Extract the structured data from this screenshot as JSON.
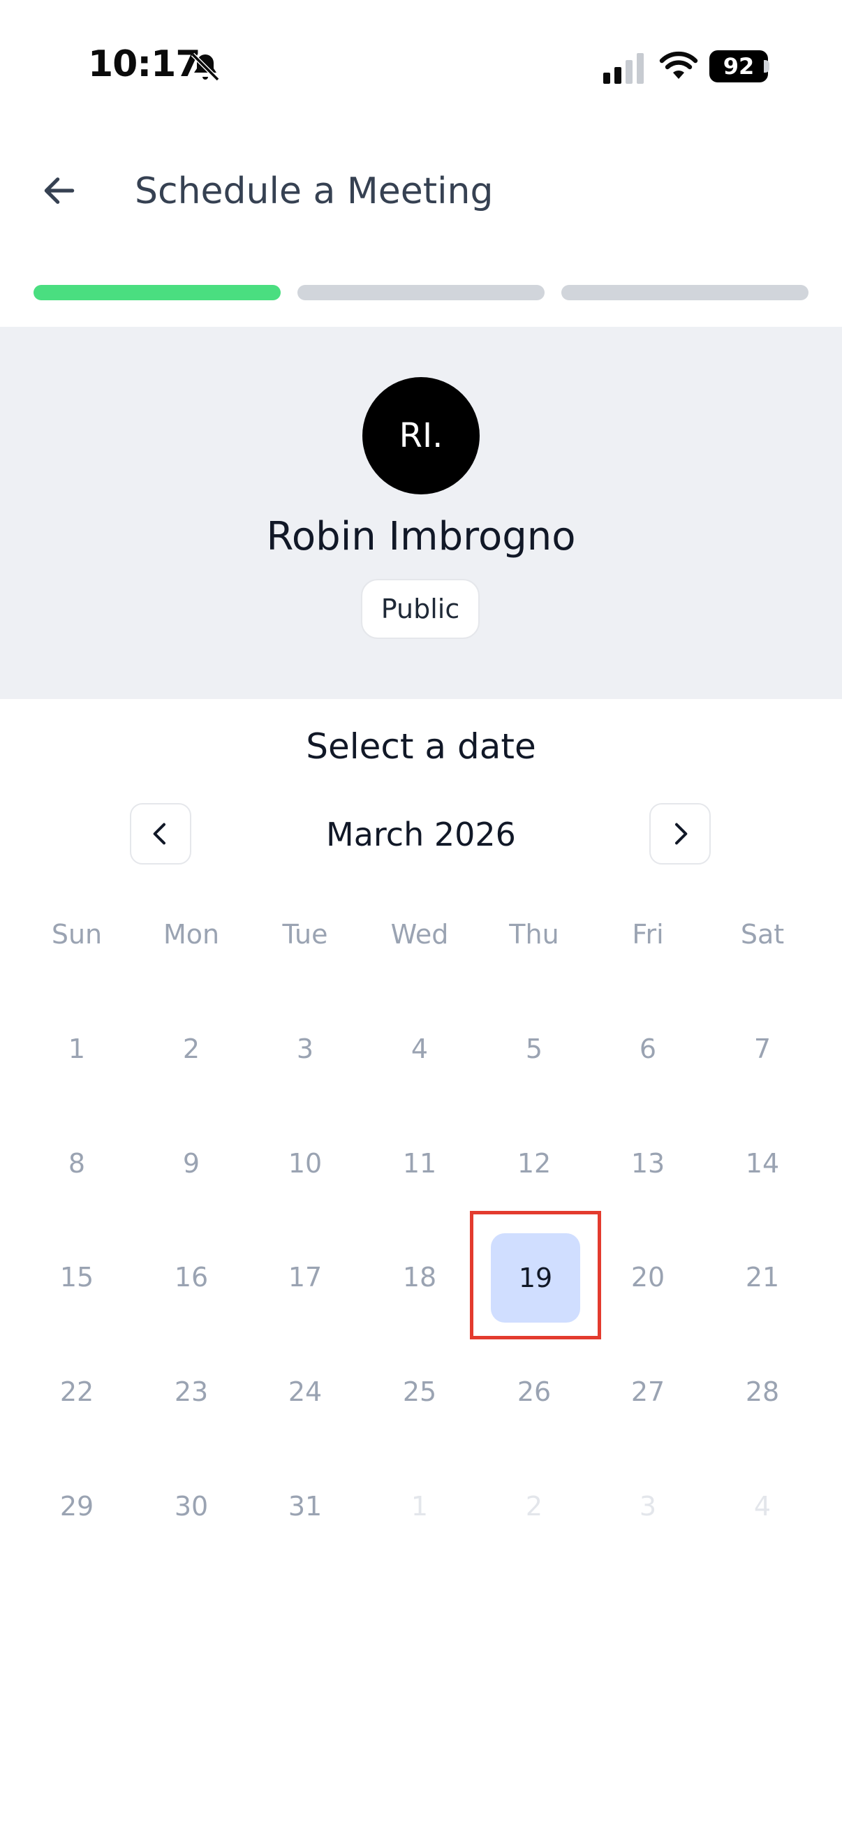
{
  "status_bar": {
    "time": "10:17",
    "battery": "92"
  },
  "header": {
    "title": "Schedule a Meeting"
  },
  "progress": {
    "steps_total": 3,
    "steps_completed": 1,
    "colors": {
      "active": "#4ade80",
      "inactive": "#d1d5db"
    }
  },
  "profile": {
    "initials": "RI.",
    "name": "Robin Imbrogno",
    "badge": "Public"
  },
  "calendar": {
    "heading": "Select a date",
    "month": "March 2026",
    "weekdays": [
      "Sun",
      "Mon",
      "Tue",
      "Wed",
      "Thu",
      "Fri",
      "Sat"
    ],
    "weeks": [
      [
        "1",
        "2",
        "3",
        "4",
        "5",
        "6",
        "7"
      ],
      [
        "8",
        "9",
        "10",
        "11",
        "12",
        "13",
        "14"
      ],
      [
        "15",
        "16",
        "17",
        "18",
        "19",
        "20",
        "21"
      ],
      [
        "22",
        "23",
        "24",
        "25",
        "26",
        "27",
        "28"
      ],
      [
        "29",
        "30",
        "31",
        "1",
        "2",
        "3",
        "4"
      ]
    ],
    "selected": "19",
    "accent": "#d0deff",
    "highlight_color": "#e33b2e"
  }
}
